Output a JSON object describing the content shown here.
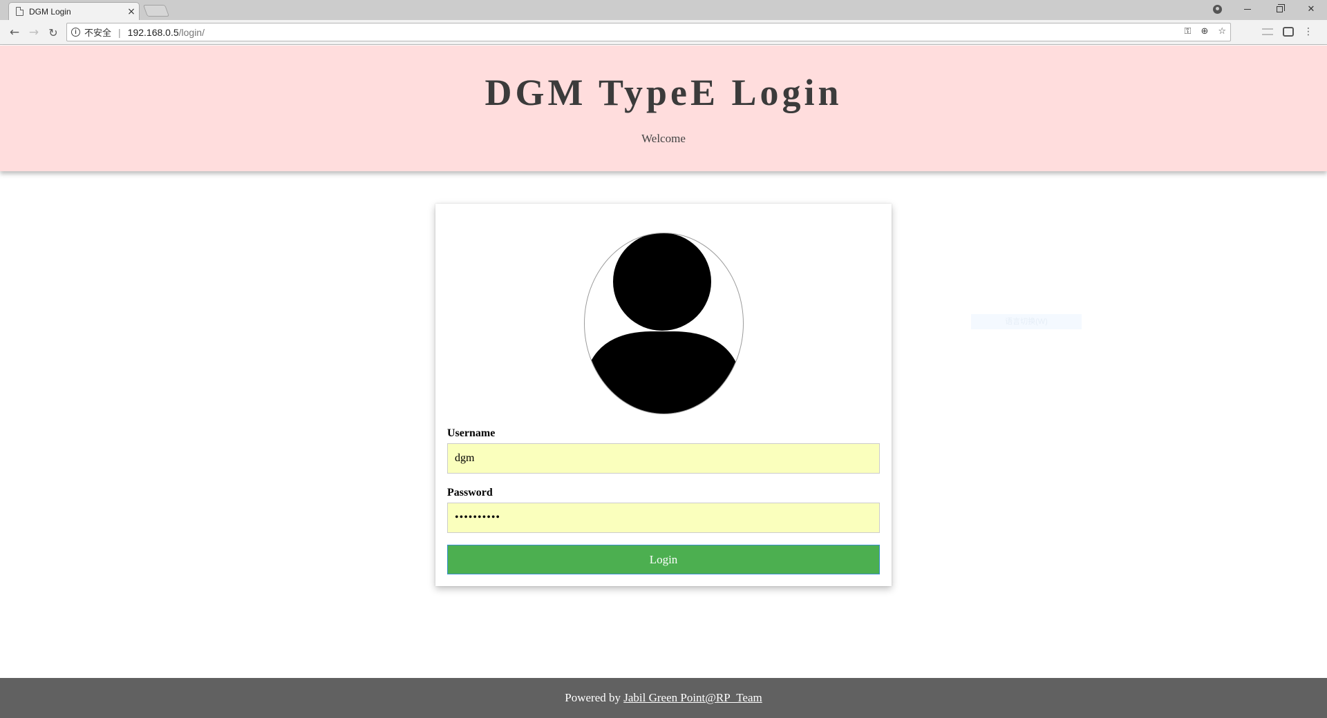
{
  "browser": {
    "tab_title": "DGM Login",
    "tab_close": "×",
    "security_label": "不安全",
    "url_host": "192.168.0.5",
    "url_path": "/login/",
    "icons": {
      "back": "arrow-left-icon",
      "forward": "arrow-right-icon",
      "reload": "reload-icon",
      "info": "info-icon",
      "key": "key-icon",
      "zoom": "zoom-icon",
      "bookmark": "star-icon"
    }
  },
  "header": {
    "title": "DGM TypeE Login",
    "subtitle": "Welcome",
    "background": "#ffdddd"
  },
  "form": {
    "username_label": "Username",
    "username_value": "dgm",
    "password_label": "Password",
    "password_value": "••••••••••",
    "login_label": "Login",
    "input_background": "#faffbd",
    "button_color": "#4caf50"
  },
  "overlay": {
    "hint_text": "语言切换(W)"
  },
  "footer": {
    "prefix": "Powered by ",
    "link_text": "Jabil Green Point@RP_Team",
    "background": "#616161"
  }
}
